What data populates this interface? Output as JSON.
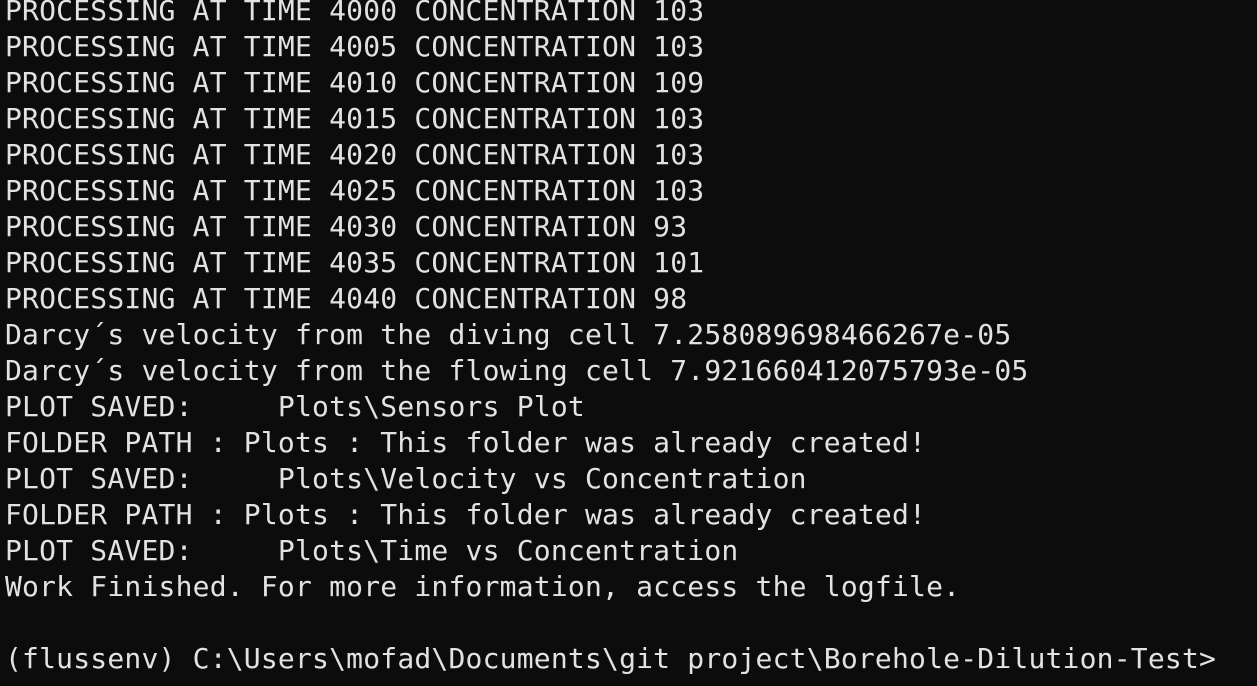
{
  "terminal": {
    "lines": [
      "PROCESSING AT TIME 4000 CONCENTRATION 103",
      "PROCESSING AT TIME 4005 CONCENTRATION 103",
      "PROCESSING AT TIME 4010 CONCENTRATION 109",
      "PROCESSING AT TIME 4015 CONCENTRATION 103",
      "PROCESSING AT TIME 4020 CONCENTRATION 103",
      "PROCESSING AT TIME 4025 CONCENTRATION 103",
      "PROCESSING AT TIME 4030 CONCENTRATION 93",
      "PROCESSING AT TIME 4035 CONCENTRATION 101",
      "PROCESSING AT TIME 4040 CONCENTRATION 98",
      "Darcy´s velocity from the diving cell 7.258089698466267e-05",
      "Darcy´s velocity from the flowing cell 7.921660412075793e-05",
      "PLOT SAVED:     Plots\\Sensors Plot",
      "FOLDER PATH : Plots : This folder was already created!",
      "PLOT SAVED:     Plots\\Velocity vs Concentration",
      "FOLDER PATH : Plots : This folder was already created!",
      "PLOT SAVED:     Plots\\Time vs Concentration",
      "Work Finished. For more information, access the logfile."
    ],
    "prompt": "(flussenv) C:\\Users\\mofad\\Documents\\git project\\Borehole-Dilution-Test>"
  }
}
